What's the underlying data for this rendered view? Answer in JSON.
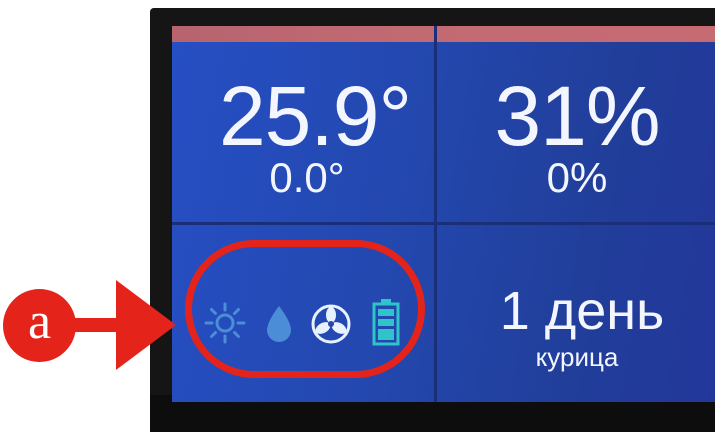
{
  "display": {
    "temperature": {
      "value": "25.9°",
      "delta": "0.0°"
    },
    "humidity": {
      "value": "31%",
      "delta": "0%"
    },
    "status_icons": [
      "sun-icon",
      "water-drop-icon",
      "fan-icon",
      "battery-icon"
    ],
    "day": {
      "value": "1 день",
      "label": "курица"
    }
  },
  "annotation": {
    "marker": "a"
  },
  "colors": {
    "screen_bg": "#2347ad",
    "stripe": "#c26a72",
    "text": "#f4f6ff",
    "icon_blue": "#4b8dd6",
    "icon_teal": "#2fc4c9",
    "annotation_red": "#e4241b"
  }
}
